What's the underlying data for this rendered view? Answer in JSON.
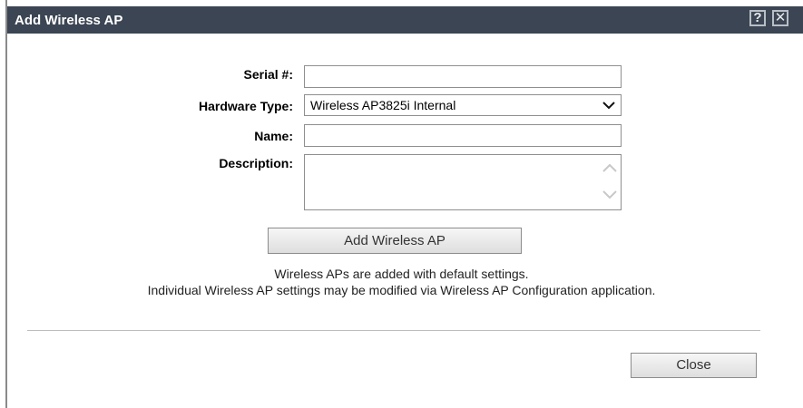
{
  "dialog": {
    "title": "Add Wireless AP",
    "help_icon": "question-mark-icon",
    "close_icon": "close-x-icon",
    "help_glyph": "?",
    "close_glyph": "✕"
  },
  "form": {
    "serial_label": "Serial #:",
    "serial_value": "",
    "hardware_label": "Hardware Type:",
    "hardware_value": "Wireless AP3825i Internal",
    "name_label": "Name:",
    "name_value": "",
    "description_label": "Description:",
    "description_value": ""
  },
  "actions": {
    "add_label": "Add Wireless AP",
    "close_label": "Close"
  },
  "notes": {
    "line1": "Wireless APs are added with default settings.",
    "line2": "Individual Wireless AP settings may be modified via Wireless AP Configuration application."
  },
  "colors": {
    "titlebar": "#3b4553",
    "title_text": "#ffffff"
  }
}
